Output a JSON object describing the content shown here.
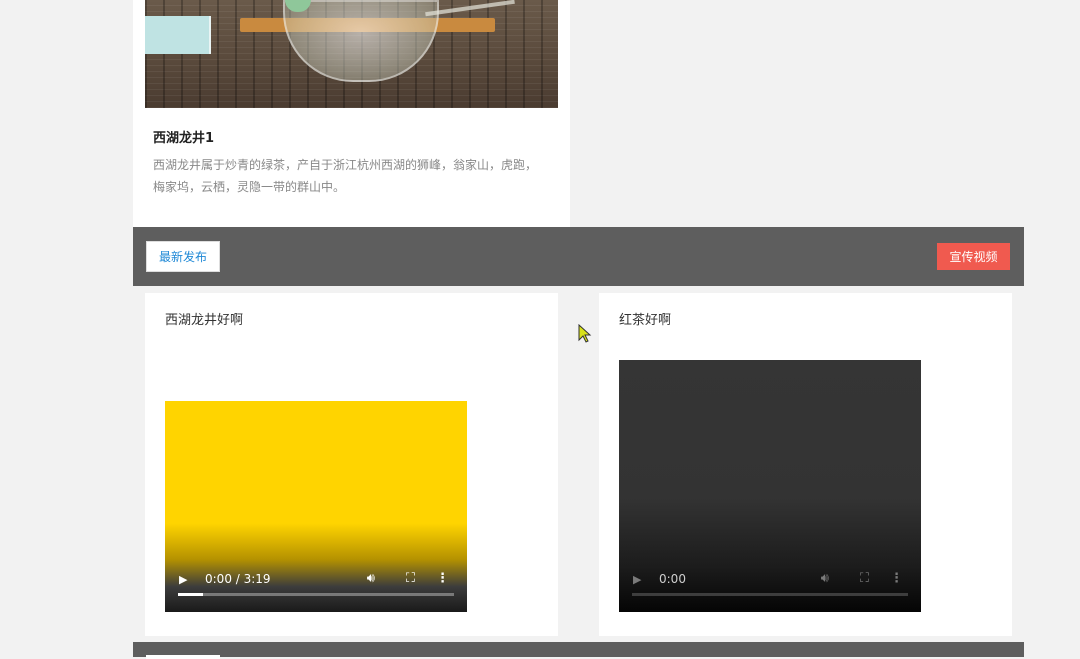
{
  "top_card": {
    "title": "西湖龙井1",
    "description": "西湖龙井属于炒青的绿茶，产自于浙江杭州西湖的狮峰，翁家山，虎跑，梅家坞，云栖，灵隐一带的群山中。"
  },
  "toolbar": {
    "latest_label": "最新发布",
    "promo_label": "宣传视频"
  },
  "videos": [
    {
      "title": "西湖龙井好啊",
      "time_display": "0:00 / 3:19",
      "progress_fraction": 0.09,
      "poster_color": "#ffd400"
    },
    {
      "title": "红茶好啊",
      "time_display": "0:00",
      "progress_fraction": 0,
      "poster_color": "#333333"
    }
  ],
  "icons": {
    "play": "play-icon",
    "volume": "volume-icon",
    "fullscreen": "fullscreen-icon",
    "more": "more-options-icon"
  },
  "colors": {
    "bar": "#5e5e5e",
    "latest_text": "#1e88d6",
    "promo_bg": "#f05a4f"
  }
}
